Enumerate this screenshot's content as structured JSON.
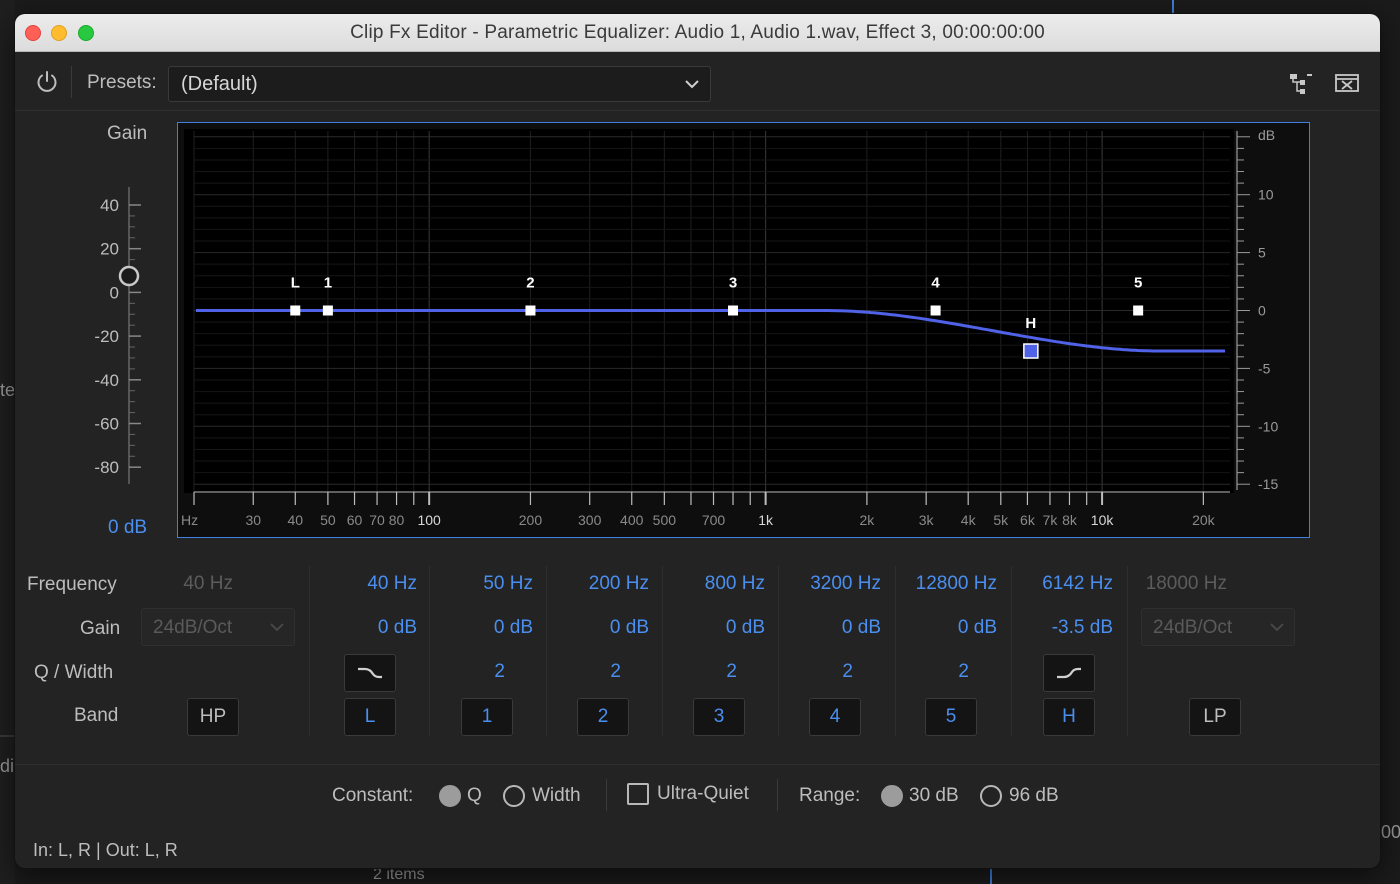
{
  "window": {
    "title": "Clip Fx Editor - Parametric Equalizer: Audio 1, Audio 1.wav, Effect 3, 00:00:00:00"
  },
  "toolbar": {
    "presets_label": "Presets:",
    "presets_value": "(Default)"
  },
  "gain": {
    "title": "Gain",
    "ticks": [
      "40",
      "20",
      "0",
      "-20",
      "-40",
      "-60",
      "-80"
    ],
    "readout": "0 dB",
    "value": 0
  },
  "graph": {
    "freq_ticks": [
      "Hz",
      "30",
      "40",
      "50",
      "60",
      "70",
      "80",
      "100",
      "200",
      "300",
      "400",
      "500",
      "700",
      "1k",
      "2k",
      "3k",
      "4k",
      "5k",
      "6k",
      "7k",
      "8k",
      "10k",
      "20k"
    ],
    "db_unit": "dB",
    "db_ticks": [
      "10",
      "5",
      "0",
      "-5",
      "-10",
      "-15"
    ],
    "curve_color": "#4f62e8",
    "nodes": [
      {
        "label": "L",
        "freq": 40,
        "gain": 0
      },
      {
        "label": "1",
        "freq": 50,
        "gain": 0
      },
      {
        "label": "2",
        "freq": 200,
        "gain": 0
      },
      {
        "label": "3",
        "freq": 800,
        "gain": 0
      },
      {
        "label": "4",
        "freq": 3200,
        "gain": 0
      },
      {
        "label": "H",
        "freq": 6142,
        "gain": -3.5
      },
      {
        "label": "5",
        "freq": 12800,
        "gain": 0
      }
    ]
  },
  "controls": {
    "labels": {
      "frequency": "Frequency",
      "gain": "Gain",
      "q_width": "Q / Width",
      "band": "Band"
    },
    "hp": {
      "frequency": "40 Hz",
      "slope": "24dB/Oct",
      "band": "HP"
    },
    "bands": [
      {
        "frequency": "40 Hz",
        "gain": "0 dB",
        "band": "L"
      },
      {
        "frequency": "50 Hz",
        "gain": "0 dB",
        "q": "2",
        "band": "1"
      },
      {
        "frequency": "200 Hz",
        "gain": "0 dB",
        "q": "2",
        "band": "2"
      },
      {
        "frequency": "800 Hz",
        "gain": "0 dB",
        "q": "2",
        "band": "3"
      },
      {
        "frequency": "3200 Hz",
        "gain": "0 dB",
        "q": "2",
        "band": "4"
      },
      {
        "frequency": "12800 Hz",
        "gain": "0 dB",
        "q": "2",
        "band": "5"
      },
      {
        "frequency": "6142 Hz",
        "gain": "-3.5 dB",
        "band": "H"
      }
    ],
    "lp": {
      "frequency": "18000 Hz",
      "slope": "24dB/Oct",
      "band": "LP"
    }
  },
  "options": {
    "constant_label": "Constant:",
    "q_label": "Q",
    "width_label": "Width",
    "constant_selected": "Q",
    "ultra_quiet_label": "Ultra-Quiet",
    "ultra_quiet_checked": false,
    "range_label": "Range:",
    "range_30": "30 dB",
    "range_96": "96 dB",
    "range_selected": "30 dB"
  },
  "io": {
    "label": "In: L, R | Out: L, R"
  },
  "background": {
    "left_text_1": "te",
    "left_text_2": "di",
    "right_text": "00:",
    "bottom_text": "2 items"
  },
  "colors": {
    "accent": "#4a8ff0",
    "frame": "#3f7fe0"
  }
}
